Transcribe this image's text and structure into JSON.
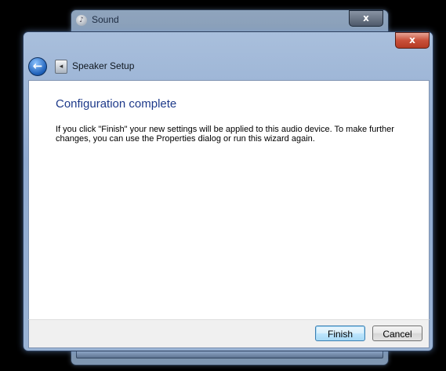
{
  "background_window": {
    "title": "Sound",
    "close_label": "x"
  },
  "dialog": {
    "nav_title": "Speaker Setup",
    "close_label": "x",
    "heading": "Configuration complete",
    "body": "If you click \"Finish\" your new settings will be applied to this audio device.  To make further changes, you can use the Properties dialog or run this wizard again.",
    "buttons": {
      "finish": "Finish",
      "cancel": "Cancel"
    }
  },
  "icons": {
    "back": "back-arrow-icon",
    "speaker": "speaker-icon",
    "sound": "sound-icon",
    "close": "close-icon"
  },
  "colors": {
    "heading": "#1e3a8a",
    "close_button": "#c9503a",
    "primary_button_border": "#3c7fb1"
  }
}
